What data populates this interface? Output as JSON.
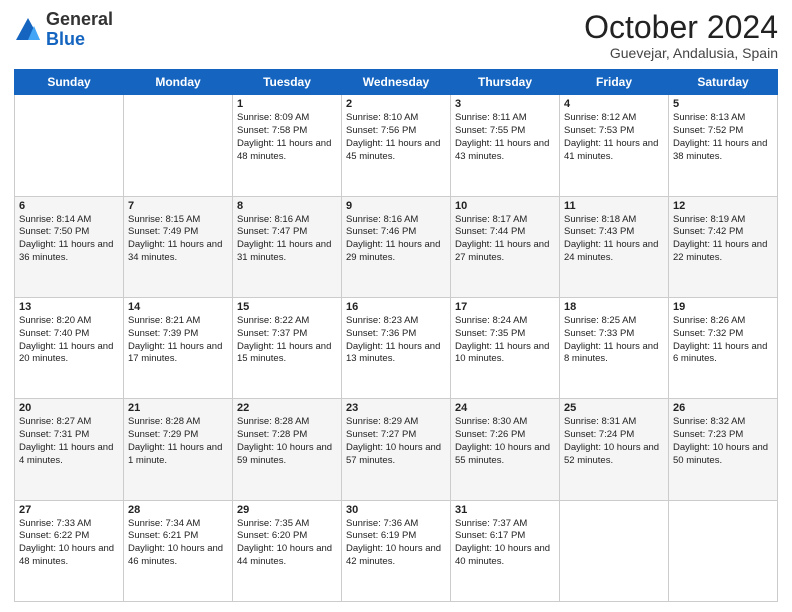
{
  "logo": {
    "general": "General",
    "blue": "Blue"
  },
  "title": "October 2024",
  "location": "Guevejar, Andalusia, Spain",
  "days_of_week": [
    "Sunday",
    "Monday",
    "Tuesday",
    "Wednesday",
    "Thursday",
    "Friday",
    "Saturday"
  ],
  "weeks": [
    [
      {
        "day": "",
        "content": ""
      },
      {
        "day": "",
        "content": ""
      },
      {
        "day": "1",
        "content": "Sunrise: 8:09 AM\nSunset: 7:58 PM\nDaylight: 11 hours and 48 minutes."
      },
      {
        "day": "2",
        "content": "Sunrise: 8:10 AM\nSunset: 7:56 PM\nDaylight: 11 hours and 45 minutes."
      },
      {
        "day": "3",
        "content": "Sunrise: 8:11 AM\nSunset: 7:55 PM\nDaylight: 11 hours and 43 minutes."
      },
      {
        "day": "4",
        "content": "Sunrise: 8:12 AM\nSunset: 7:53 PM\nDaylight: 11 hours and 41 minutes."
      },
      {
        "day": "5",
        "content": "Sunrise: 8:13 AM\nSunset: 7:52 PM\nDaylight: 11 hours and 38 minutes."
      }
    ],
    [
      {
        "day": "6",
        "content": "Sunrise: 8:14 AM\nSunset: 7:50 PM\nDaylight: 11 hours and 36 minutes."
      },
      {
        "day": "7",
        "content": "Sunrise: 8:15 AM\nSunset: 7:49 PM\nDaylight: 11 hours and 34 minutes."
      },
      {
        "day": "8",
        "content": "Sunrise: 8:16 AM\nSunset: 7:47 PM\nDaylight: 11 hours and 31 minutes."
      },
      {
        "day": "9",
        "content": "Sunrise: 8:16 AM\nSunset: 7:46 PM\nDaylight: 11 hours and 29 minutes."
      },
      {
        "day": "10",
        "content": "Sunrise: 8:17 AM\nSunset: 7:44 PM\nDaylight: 11 hours and 27 minutes."
      },
      {
        "day": "11",
        "content": "Sunrise: 8:18 AM\nSunset: 7:43 PM\nDaylight: 11 hours and 24 minutes."
      },
      {
        "day": "12",
        "content": "Sunrise: 8:19 AM\nSunset: 7:42 PM\nDaylight: 11 hours and 22 minutes."
      }
    ],
    [
      {
        "day": "13",
        "content": "Sunrise: 8:20 AM\nSunset: 7:40 PM\nDaylight: 11 hours and 20 minutes."
      },
      {
        "day": "14",
        "content": "Sunrise: 8:21 AM\nSunset: 7:39 PM\nDaylight: 11 hours and 17 minutes."
      },
      {
        "day": "15",
        "content": "Sunrise: 8:22 AM\nSunset: 7:37 PM\nDaylight: 11 hours and 15 minutes."
      },
      {
        "day": "16",
        "content": "Sunrise: 8:23 AM\nSunset: 7:36 PM\nDaylight: 11 hours and 13 minutes."
      },
      {
        "day": "17",
        "content": "Sunrise: 8:24 AM\nSunset: 7:35 PM\nDaylight: 11 hours and 10 minutes."
      },
      {
        "day": "18",
        "content": "Sunrise: 8:25 AM\nSunset: 7:33 PM\nDaylight: 11 hours and 8 minutes."
      },
      {
        "day": "19",
        "content": "Sunrise: 8:26 AM\nSunset: 7:32 PM\nDaylight: 11 hours and 6 minutes."
      }
    ],
    [
      {
        "day": "20",
        "content": "Sunrise: 8:27 AM\nSunset: 7:31 PM\nDaylight: 11 hours and 4 minutes."
      },
      {
        "day": "21",
        "content": "Sunrise: 8:28 AM\nSunset: 7:29 PM\nDaylight: 11 hours and 1 minute."
      },
      {
        "day": "22",
        "content": "Sunrise: 8:28 AM\nSunset: 7:28 PM\nDaylight: 10 hours and 59 minutes."
      },
      {
        "day": "23",
        "content": "Sunrise: 8:29 AM\nSunset: 7:27 PM\nDaylight: 10 hours and 57 minutes."
      },
      {
        "day": "24",
        "content": "Sunrise: 8:30 AM\nSunset: 7:26 PM\nDaylight: 10 hours and 55 minutes."
      },
      {
        "day": "25",
        "content": "Sunrise: 8:31 AM\nSunset: 7:24 PM\nDaylight: 10 hours and 52 minutes."
      },
      {
        "day": "26",
        "content": "Sunrise: 8:32 AM\nSunset: 7:23 PM\nDaylight: 10 hours and 50 minutes."
      }
    ],
    [
      {
        "day": "27",
        "content": "Sunrise: 7:33 AM\nSunset: 6:22 PM\nDaylight: 10 hours and 48 minutes."
      },
      {
        "day": "28",
        "content": "Sunrise: 7:34 AM\nSunset: 6:21 PM\nDaylight: 10 hours and 46 minutes."
      },
      {
        "day": "29",
        "content": "Sunrise: 7:35 AM\nSunset: 6:20 PM\nDaylight: 10 hours and 44 minutes."
      },
      {
        "day": "30",
        "content": "Sunrise: 7:36 AM\nSunset: 6:19 PM\nDaylight: 10 hours and 42 minutes."
      },
      {
        "day": "31",
        "content": "Sunrise: 7:37 AM\nSunset: 6:17 PM\nDaylight: 10 hours and 40 minutes."
      },
      {
        "day": "",
        "content": ""
      },
      {
        "day": "",
        "content": ""
      }
    ]
  ]
}
